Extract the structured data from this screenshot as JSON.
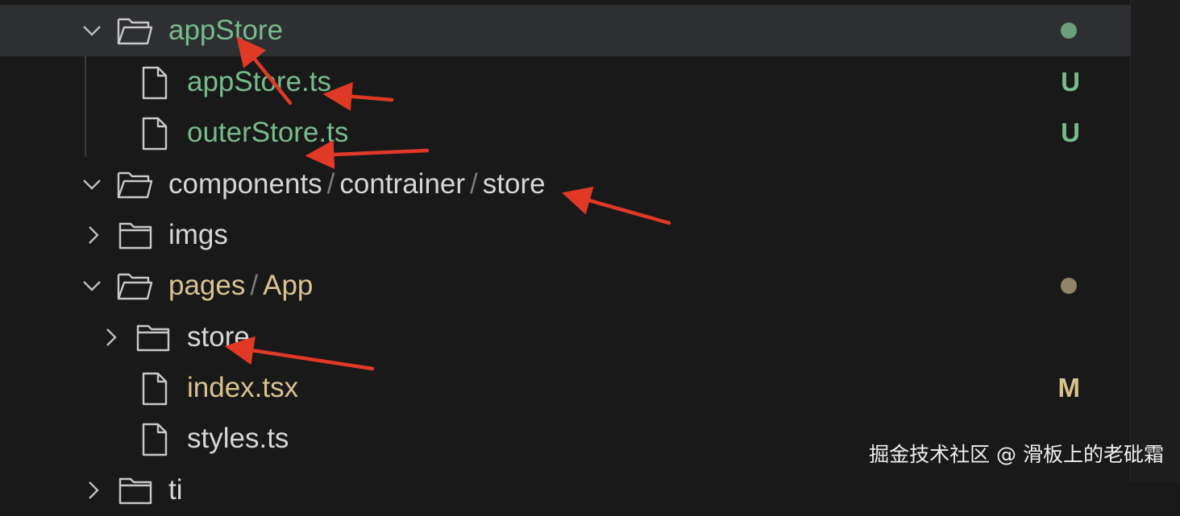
{
  "rows": [
    {
      "name": "appStore",
      "kind": "folder",
      "expanded": true,
      "selected": true,
      "color": "green",
      "status_dot": "#6a9e7c"
    },
    {
      "name": "appStore.ts",
      "kind": "file",
      "color": "green",
      "status": "U"
    },
    {
      "name": "outerStore.ts",
      "kind": "file",
      "color": "green",
      "status": "U"
    },
    {
      "segments": [
        "components",
        "contrainer",
        "store"
      ],
      "kind": "folder",
      "expanded": true,
      "color": "white"
    },
    {
      "name": "imgs",
      "kind": "folder",
      "expanded": false,
      "color": "white"
    },
    {
      "segments": [
        "pages",
        "App"
      ],
      "kind": "folder",
      "expanded": true,
      "color": "yellow",
      "status_dot": "#8f8566"
    },
    {
      "name": "store",
      "kind": "folder",
      "expanded": false,
      "color": "white"
    },
    {
      "name": "index.tsx",
      "kind": "file",
      "color": "yellow",
      "status": "M"
    },
    {
      "name": "styles.ts",
      "kind": "file",
      "color": "white"
    },
    {
      "name": "ti",
      "kind": "folder",
      "expanded": false,
      "color": "white",
      "partial": true
    }
  ],
  "colors": {
    "green": "#77bb8c",
    "yellow": "#d8c38f",
    "status_U": "#77bb8c",
    "status_M": "#d8c38f",
    "arrow": "#e03a26"
  },
  "watermark": "掘金技术社区 @ 滑板上的老砒霜",
  "separator": "/"
}
